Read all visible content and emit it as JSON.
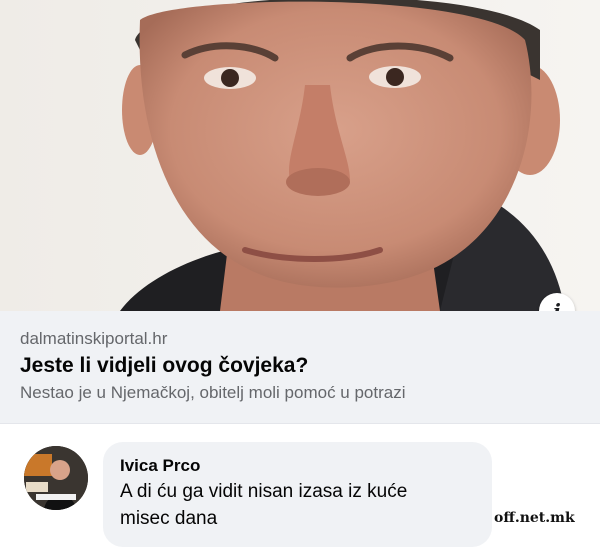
{
  "preview": {
    "domain": "dalmatinskiportal.hr",
    "headline": "Jeste li vidjeli ovog čovjeka?",
    "subline": "Nestao je u Njemačkoj, obitelj moli pomoć u potrazi",
    "info_icon": "info-icon"
  },
  "comment": {
    "author": "Ivica Prco",
    "text": "A di ću ga vidit nisan izasa iz kuće misec dana",
    "avatar_icon": "avatar"
  },
  "watermark": "off.net.mk",
  "colors": {
    "card_background": "#f0f2f5",
    "text_primary": "#050505",
    "text_secondary": "#65676b"
  }
}
